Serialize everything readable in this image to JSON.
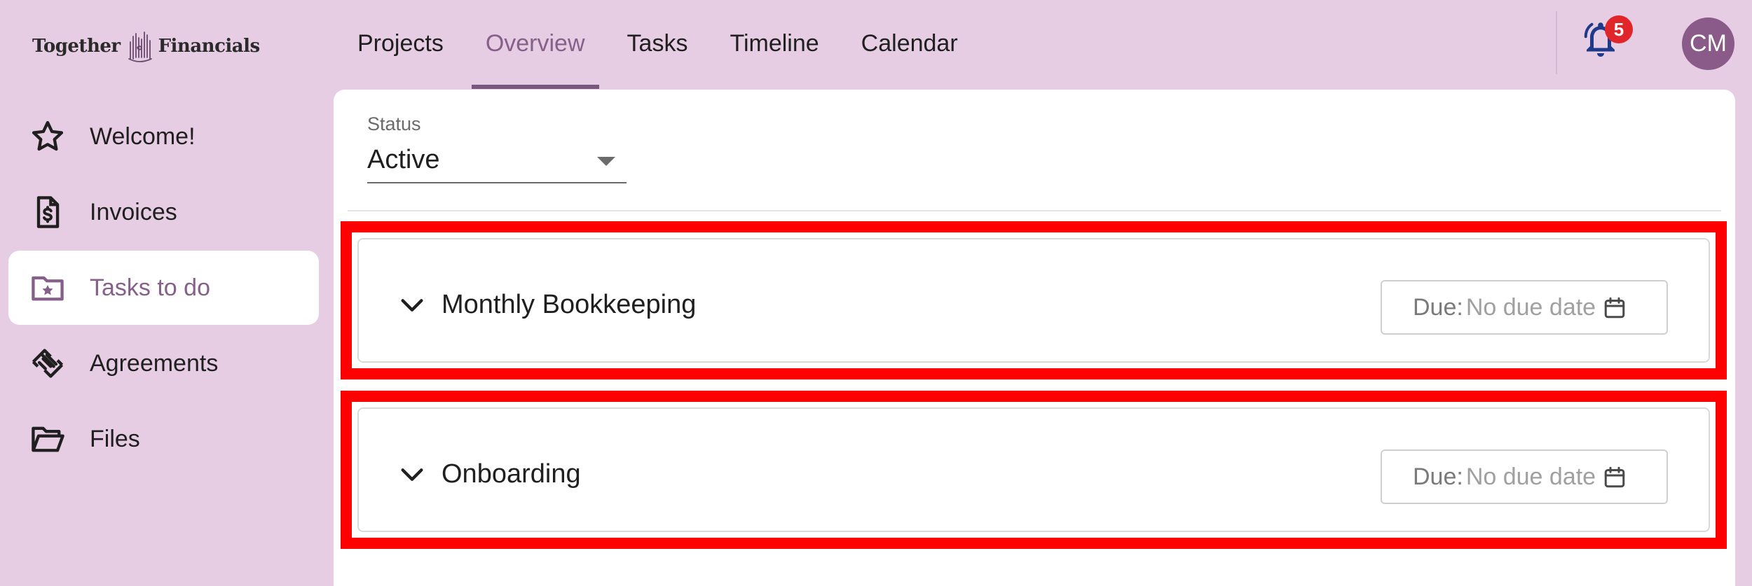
{
  "brand": {
    "left": "Together",
    "right": "Financials"
  },
  "top_nav": {
    "tabs": [
      {
        "label": "Projects",
        "active": false
      },
      {
        "label": "Overview",
        "active": true
      },
      {
        "label": "Tasks",
        "active": false
      },
      {
        "label": "Timeline",
        "active": false
      },
      {
        "label": "Calendar",
        "active": false
      }
    ],
    "notifications_count": "5",
    "avatar_initials": "CM"
  },
  "sidebar": {
    "items": [
      {
        "label": "Welcome!",
        "icon": "star-icon",
        "active": false
      },
      {
        "label": "Invoices",
        "icon": "invoice-icon",
        "active": false
      },
      {
        "label": "Tasks to do",
        "icon": "folder-star-icon",
        "active": true
      },
      {
        "label": "Agreements",
        "icon": "handshake-icon",
        "active": false
      },
      {
        "label": "Files",
        "icon": "folder-open-icon",
        "active": false
      }
    ]
  },
  "filter": {
    "label": "Status",
    "value": "Active"
  },
  "tasks": [
    {
      "title": "Monthly Bookkeeping",
      "due_label": "Due:",
      "due_value": "No due date"
    },
    {
      "title": "Onboarding",
      "due_label": "Due:",
      "due_value": "No due date"
    }
  ],
  "colors": {
    "background": "#e6cde3",
    "accent": "#86608a",
    "highlight": "#ff0000",
    "badge": "#e0262b",
    "avatar": "#8a5a88"
  }
}
